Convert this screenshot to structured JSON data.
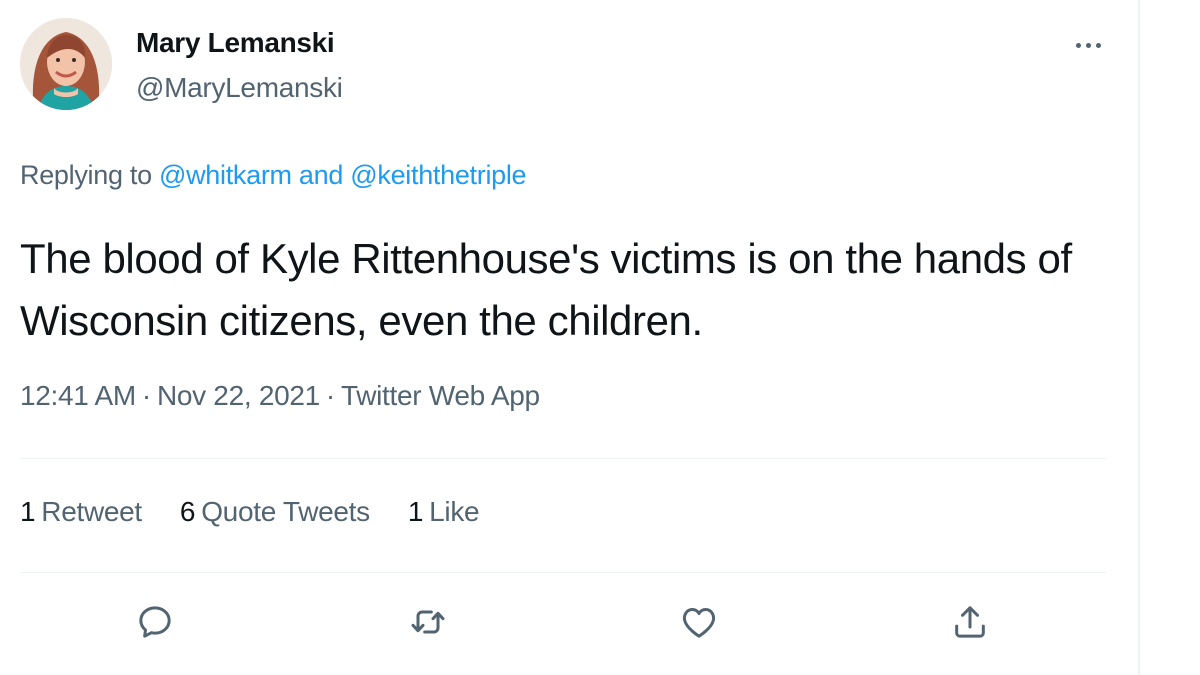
{
  "author": {
    "display_name": "Mary Lemanski",
    "handle": "@MaryLemanski"
  },
  "reply_context": {
    "prefix": "Replying to ",
    "mention_1": "@whitkarm",
    "connector": " and ",
    "mention_2": "@keiththetriple"
  },
  "tweet": {
    "text": "The blood of Kyle Rittenhouse's victims is on the hands of Wisconsin citizens, even the children."
  },
  "meta": {
    "time": "12:41 AM",
    "separator_1": "·",
    "date": "Nov 22, 2021",
    "separator_2": "·",
    "source": "Twitter Web App"
  },
  "stats": {
    "retweets_count": "1",
    "retweets_label": "Retweet",
    "quotes_count": "6",
    "quotes_label": "Quote Tweets",
    "likes_count": "1",
    "likes_label": "Like"
  },
  "actions": [
    "reply-icon",
    "retweet-icon",
    "like-icon",
    "share-icon"
  ],
  "colors": {
    "link": "#1d9bf0",
    "secondary_text": "#536471",
    "primary_text": "#0f1419",
    "divider": "#eff3f4"
  }
}
